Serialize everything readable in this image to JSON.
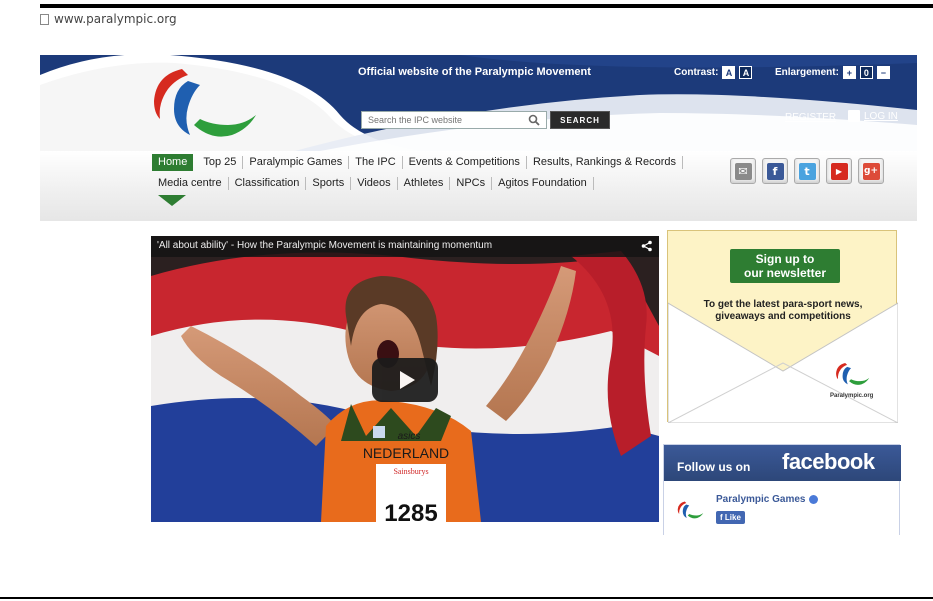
{
  "browser": {
    "url": "www.paralympic.org"
  },
  "header": {
    "tagline": "Official website of the Paralympic Movement",
    "contrast_label": "Contrast:",
    "contrast_options": [
      "A",
      "A"
    ],
    "enlargement_label": "Enlargement:",
    "enlargement_controls": [
      "+",
      "0",
      "−"
    ],
    "search_placeholder": "Search the IPC website",
    "search_button": "SEARCH",
    "register": "REGISTER",
    "login": "LOG IN"
  },
  "nav": {
    "row1": [
      "Home",
      "Top 25",
      "Paralympic Games",
      "The IPC",
      "Events & Competitions",
      "Results, Rankings & Records"
    ],
    "row2": [
      "Media centre",
      "Classification",
      "Sports",
      "Videos",
      "Athletes",
      "NPCs",
      "Agitos Foundation"
    ]
  },
  "social": [
    {
      "name": "email",
      "glyph": "✉",
      "color": "#8a8a8a"
    },
    {
      "name": "facebook",
      "glyph": "f",
      "color": "#3b5998"
    },
    {
      "name": "twitter",
      "glyph": "t",
      "color": "#4aa3df"
    },
    {
      "name": "youtube",
      "glyph": "▶",
      "color": "#d62a1f"
    },
    {
      "name": "google-plus",
      "glyph": "g+",
      "color": "#dd4b39"
    }
  ],
  "video": {
    "title": "'All about ability' - How the Paralympic Movement is maintaining momentum",
    "shirt_text": "NEDERLAND",
    "bib_sponsor": "Sainsburys",
    "bib_number": "1285",
    "brand": "asics"
  },
  "newsletter": {
    "button_line1": "Sign up to",
    "button_line2": "our newsletter",
    "text": "To get the latest para-sport news, giveaways and competitions",
    "logo_text": "Paralympic.org"
  },
  "facebook": {
    "follow_label": "Follow us on",
    "brand": "facebook",
    "page_name": "Paralympic Games",
    "like_label": "Like"
  },
  "colors": {
    "header_blue": "#1c3a7a",
    "nav_green": "#2e7d32",
    "agitos_red": "#d62a1f",
    "agitos_blue": "#1f5fb0",
    "agitos_green": "#2e9e3c"
  }
}
